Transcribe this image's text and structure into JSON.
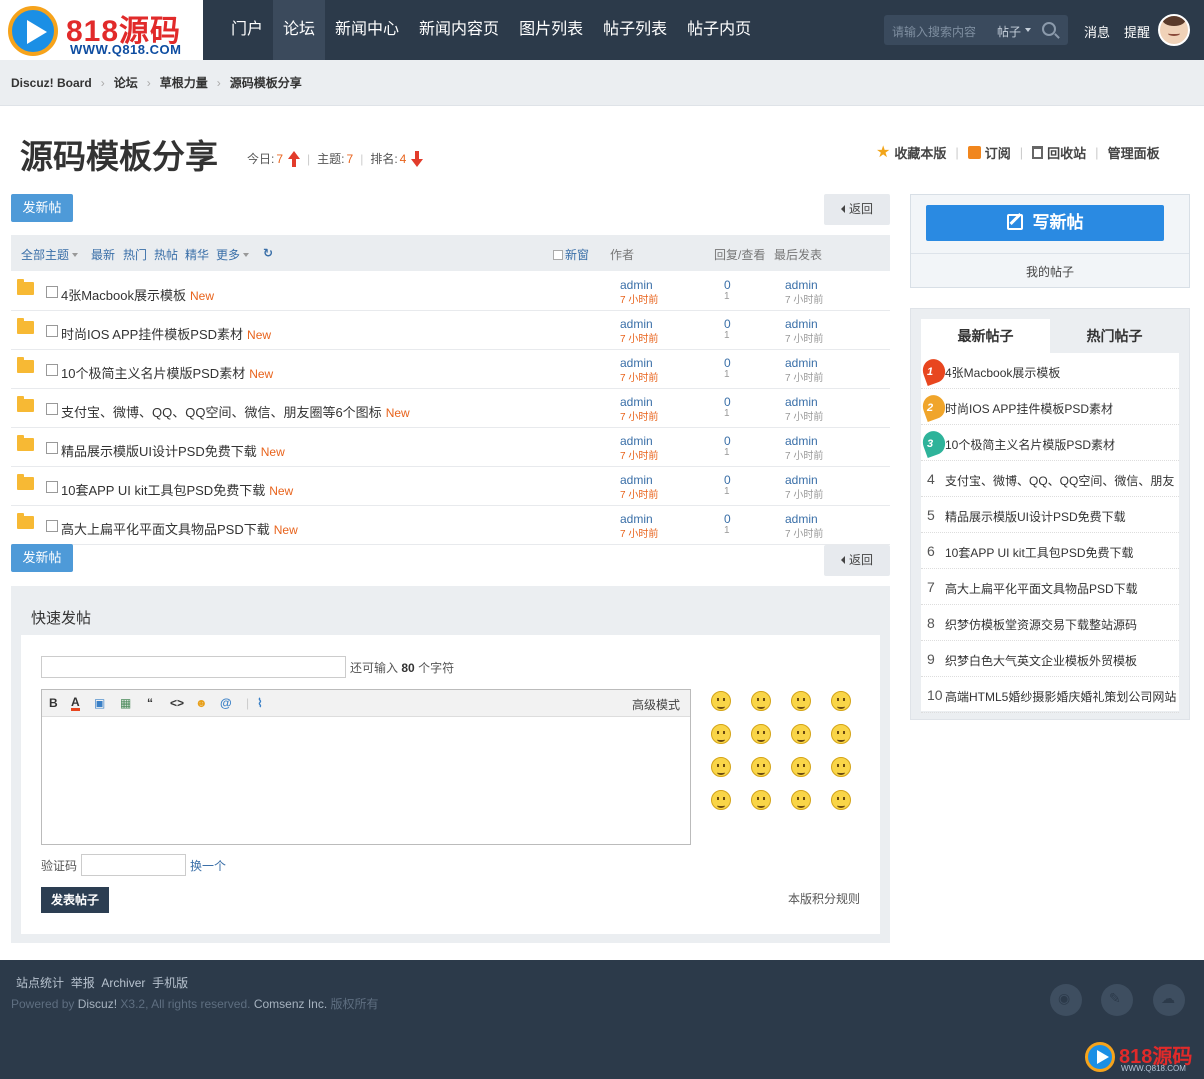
{
  "logo": {
    "brand": "818源码",
    "url": "WWW.Q818.COM"
  },
  "nav": [
    "门户",
    "论坛",
    "新闻中心",
    "新闻内容页",
    "图片列表",
    "帖子列表",
    "帖子内页"
  ],
  "search": {
    "placeholder": "请输入搜索内容",
    "type": "帖子"
  },
  "user": {
    "messages": "消息",
    "remind": "提醒"
  },
  "breadcrumb": [
    "Discuz! Board",
    "论坛",
    "草根力量",
    "源码模板分享"
  ],
  "forum": {
    "title": "源码模板分享",
    "today_label": "今日:",
    "today": "7",
    "topics_label": "主题:",
    "topics": "7",
    "rank_label": "排名:",
    "rank": "4",
    "actions": {
      "favorite": "收藏本版",
      "subscribe": "订阅",
      "recycle": "回收站",
      "admin": "管理面板"
    }
  },
  "buttons": {
    "new_post": "发新帖",
    "back": "返回"
  },
  "list_head": {
    "all": "全部主题",
    "latest": "最新",
    "hot": "热门",
    "hotpost": "热帖",
    "digest": "精华",
    "more": "更多",
    "refresh": "↻",
    "newwin": "新窗",
    "author": "作者",
    "replies": "回复/查看",
    "last": "最后发表"
  },
  "threads": [
    {
      "title": "4张Macbook展示模板",
      "tag": "New",
      "author": "admin",
      "time": "7 小时前",
      "replies": "0",
      "views": "1",
      "last_user": "admin",
      "last_time": "7 小时前"
    },
    {
      "title": "时尚IOS APP挂件模板PSD素材",
      "tag": "New",
      "author": "admin",
      "time": "7 小时前",
      "replies": "0",
      "views": "1",
      "last_user": "admin",
      "last_time": "7 小时前"
    },
    {
      "title": "10个极简主义名片模版PSD素材",
      "tag": "New",
      "author": "admin",
      "time": "7 小时前",
      "replies": "0",
      "views": "1",
      "last_user": "admin",
      "last_time": "7 小时前"
    },
    {
      "title": "支付宝、微博、QQ、QQ空间、微信、朋友圈等6个图标",
      "tag": "New",
      "author": "admin",
      "time": "7 小时前",
      "replies": "0",
      "views": "1",
      "last_user": "admin",
      "last_time": "7 小时前"
    },
    {
      "title": "精品展示模版UI设计PSD免费下载",
      "tag": "New",
      "author": "admin",
      "time": "7 小时前",
      "replies": "0",
      "views": "1",
      "last_user": "admin",
      "last_time": "7 小时前"
    },
    {
      "title": "10套APP UI kit工具包PSD免费下载",
      "tag": "New",
      "author": "admin",
      "time": "7 小时前",
      "replies": "0",
      "views": "1",
      "last_user": "admin",
      "last_time": "7 小时前"
    },
    {
      "title": "高大上扁平化平面文具物品PSD下载",
      "tag": "New",
      "author": "admin",
      "time": "7 小时前",
      "replies": "0",
      "views": "1",
      "last_user": "admin",
      "last_time": "7 小时前"
    }
  ],
  "quick": {
    "title": "快速发帖",
    "remain_prefix": "还可输入",
    "remain": "80",
    "remain_suffix": "个字符",
    "advanced": "高级模式",
    "captcha_label": "验证码",
    "captcha_change": "换一个",
    "submit": "发表帖子",
    "rules": "本版积分规则",
    "toolbar": [
      "B",
      "A",
      "▣",
      "▦",
      "“",
      "<>",
      "☻",
      "@",
      "|",
      "⌇"
    ]
  },
  "sidebar": {
    "write": "写新帖",
    "my_threads": "我的帖子",
    "tab_latest": "最新帖子",
    "tab_hot": "热门帖子",
    "hot": [
      {
        "rank": "1",
        "title": "4张Macbook展示模板"
      },
      {
        "rank": "2",
        "title": "时尚IOS APP挂件模板PSD素材"
      },
      {
        "rank": "3",
        "title": "10个极简主义名片模版PSD素材"
      },
      {
        "rank": "4",
        "title": "支付宝、微博、QQ、QQ空间、微信、朋友"
      },
      {
        "rank": "5",
        "title": "精品展示模版UI设计PSD免费下载"
      },
      {
        "rank": "6",
        "title": "10套APP UI kit工具包PSD免费下载"
      },
      {
        "rank": "7",
        "title": "高大上扁平化平面文具物品PSD下载"
      },
      {
        "rank": "8",
        "title": "织梦仿模板堂资源交易下载整站源码"
      },
      {
        "rank": "9",
        "title": "织梦白色大气英文企业模板外贸模板"
      },
      {
        "rank": "10",
        "title": "高端HTML5婚纱摄影婚庆婚礼策划公司网站"
      }
    ],
    "medal_colors": [
      "#e8461f",
      "#f0a52b",
      "#2eb39a"
    ]
  },
  "footer": {
    "links": [
      "站点统计",
      "举报",
      "Archiver",
      "手机版"
    ],
    "powered": "Powered by",
    "discuz": "Discuz!",
    "version": "X3.2",
    "rights": ", All rights reserved.",
    "company": "Comsenz Inc.",
    "copyright": "版权所有",
    "brand": "818源码",
    "url": "WWW.Q818.COM",
    "social_icons": [
      "weibo-icon",
      "tencent-weibo-icon",
      "cloud-icon"
    ]
  }
}
